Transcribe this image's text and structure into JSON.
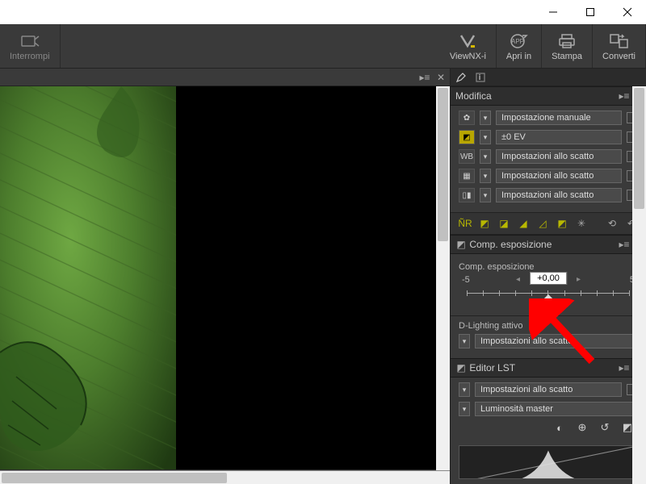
{
  "toolbar": {
    "left": {
      "interrompi": "Interrompi"
    },
    "right": {
      "viewnxi": "ViewNX-i",
      "apri_in": "Apri in",
      "stampa": "Stampa",
      "converti": "Converti"
    }
  },
  "panels": {
    "modifica": {
      "title": "Modifica",
      "rows": [
        {
          "label": "Impostazione manuale"
        },
        {
          "label": "±0 EV"
        },
        {
          "label": "Impostazioni allo scatto"
        },
        {
          "label": "Impostazioni allo scatto"
        },
        {
          "label": "Impostazioni allo scatto"
        }
      ]
    },
    "comp_esp": {
      "title": "Comp. esposizione",
      "section_label": "Comp. esposizione",
      "slider": {
        "min": "-5",
        "max": "5",
        "value": "+0,00"
      },
      "dlighting_label": "D-Lighting attivo",
      "dlighting_value": "Impostazioni allo scatto"
    },
    "editor_lst": {
      "title": "Editor LST",
      "rows": [
        {
          "label": "Impostazioni allo scatto"
        },
        {
          "label": "Luminosità master"
        }
      ]
    }
  }
}
